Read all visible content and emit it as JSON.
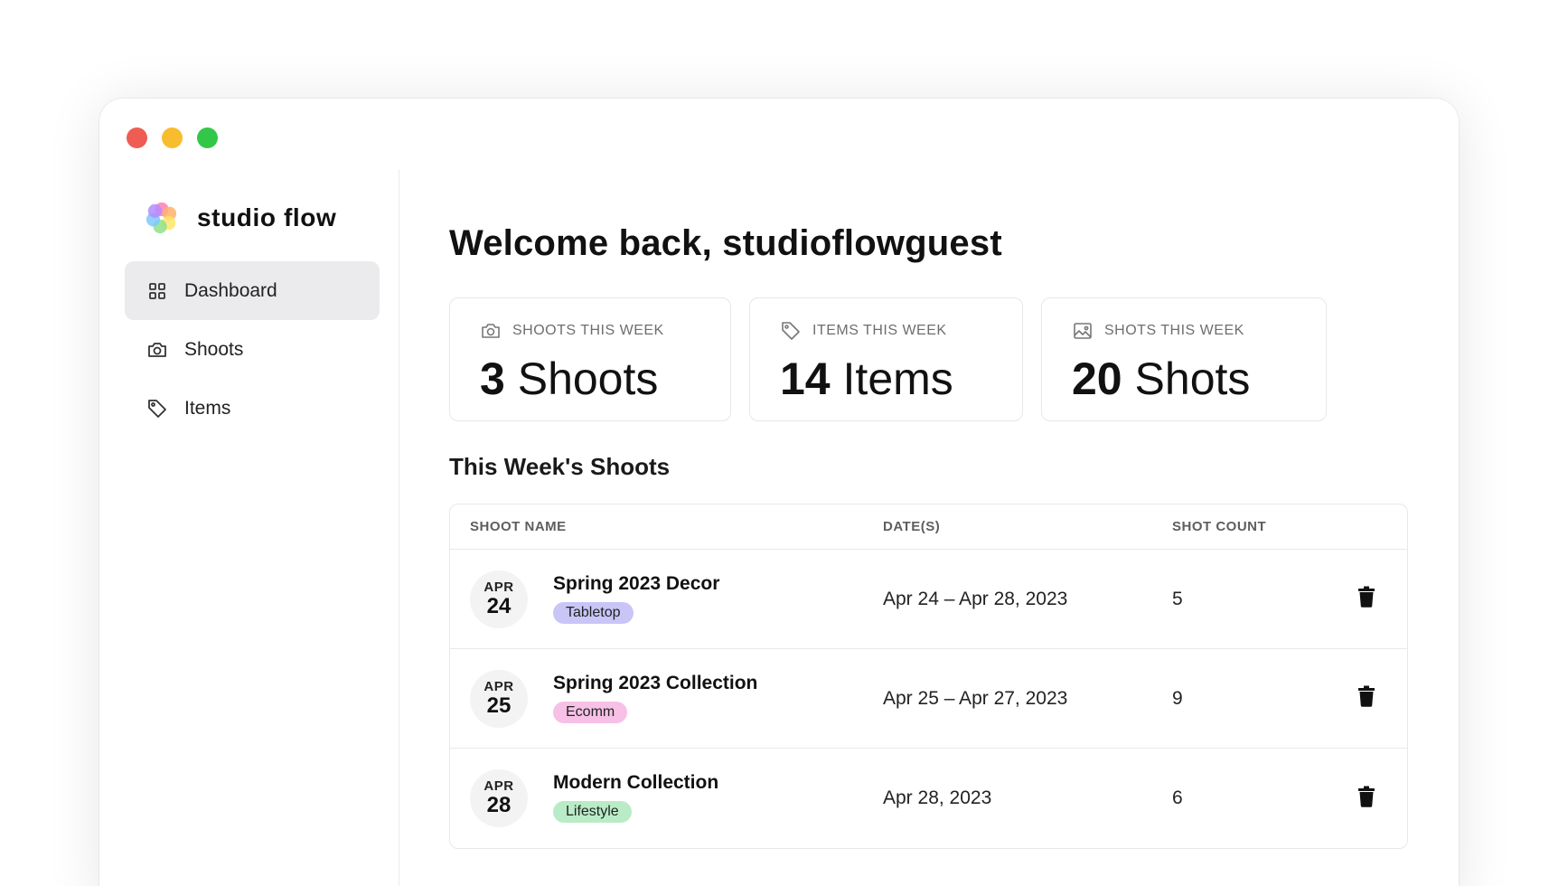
{
  "app": {
    "name": "studio flow"
  },
  "window_controls": {
    "close_color": "#ee5c54",
    "minimize_color": "#f7bd2e",
    "maximize_color": "#33c748"
  },
  "sidebar": {
    "items": [
      {
        "label": "Dashboard",
        "icon": "grid-icon",
        "active": true
      },
      {
        "label": "Shoots",
        "icon": "camera-icon",
        "active": false
      },
      {
        "label": "Items",
        "icon": "tag-icon",
        "active": false
      }
    ]
  },
  "main": {
    "welcome": "Welcome back, studioflowguest",
    "stats": [
      {
        "label": "SHOOTS THIS WEEK",
        "number": "3",
        "unit": "Shoots",
        "icon": "camera-icon"
      },
      {
        "label": "ITEMS THIS WEEK",
        "number": "14",
        "unit": "Items",
        "icon": "tag-icon"
      },
      {
        "label": "SHOTS THIS WEEK",
        "number": "20",
        "unit": "Shots",
        "icon": "image-icon"
      }
    ],
    "section_title": "This Week's Shoots",
    "table": {
      "headers": {
        "name": "SHOOT NAME",
        "dates": "DATE(S)",
        "count": "SHOT COUNT"
      },
      "rows": [
        {
          "month": "APR",
          "day": "24",
          "name": "Spring 2023 Decor",
          "tag": "Tabletop",
          "tag_color": "#c9c5f7",
          "dates": "Apr 24 – Apr 28, 2023",
          "count": "5"
        },
        {
          "month": "APR",
          "day": "25",
          "name": "Spring 2023 Collection",
          "tag": "Ecomm",
          "tag_color": "#f7c0e6",
          "dates": "Apr 25 – Apr 27, 2023",
          "count": "9"
        },
        {
          "month": "APR",
          "day": "28",
          "name": "Modern Collection",
          "tag": "Lifestyle",
          "tag_color": "#b9ecc6",
          "dates": "Apr 28, 2023",
          "count": "6"
        }
      ]
    }
  }
}
